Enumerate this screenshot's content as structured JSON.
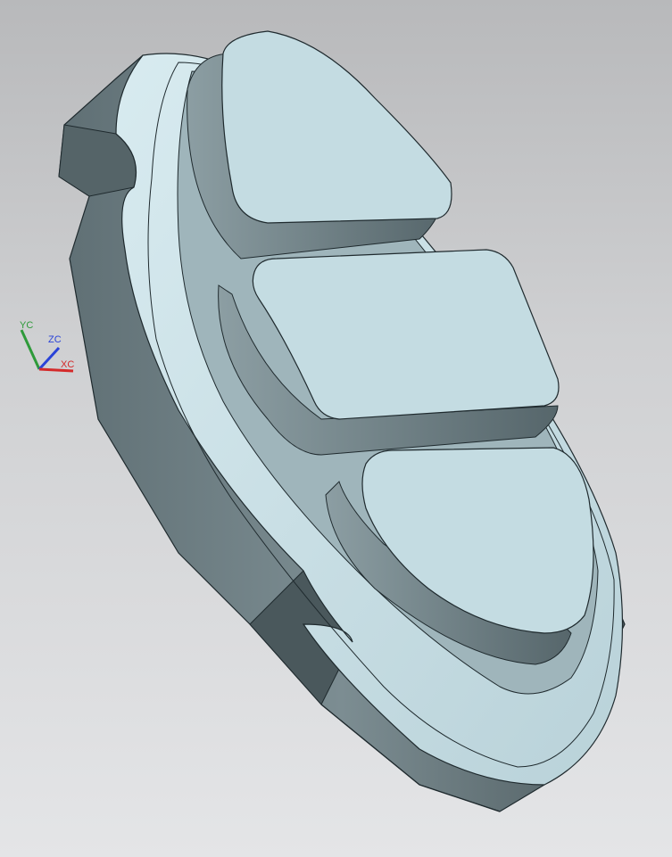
{
  "viewport": {
    "background_top": "#b8b9bb",
    "background_bottom": "#e4e5e7"
  },
  "model": {
    "face_color": "#c6dde3",
    "side_color": "#6e7f84",
    "edge_color": "#1f2a2e"
  },
  "triad": {
    "x_label": "XC",
    "y_label": "YC",
    "z_label": "ZC",
    "x_color": "#d42a2a",
    "y_color": "#2e9a3a",
    "z_color": "#2a43d8"
  }
}
